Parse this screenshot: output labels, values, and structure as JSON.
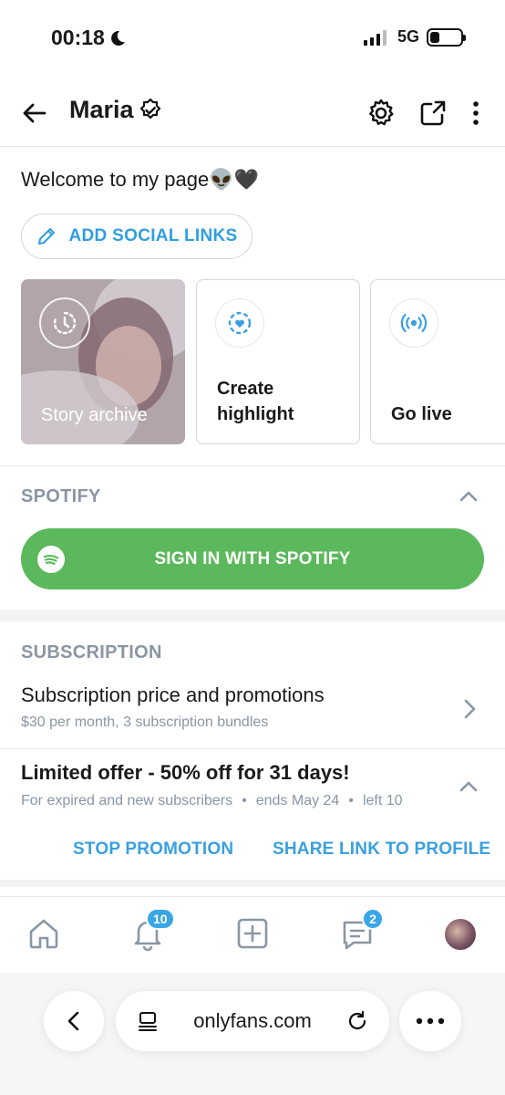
{
  "status_bar": {
    "time": "00:18",
    "network": "5G",
    "battery_percent": 30
  },
  "header": {
    "title": "Maria"
  },
  "profile": {
    "bio": "Welcome to my page👽🖤",
    "add_social_links": "ADD SOCIAL LINKS"
  },
  "cards": [
    {
      "label": "Story archive",
      "icon": "history-clock-icon"
    },
    {
      "label_line1": "Create",
      "label_line2": "highlight",
      "icon": "highlight-heart-icon"
    },
    {
      "label": "Go live",
      "icon": "broadcast-icon"
    }
  ],
  "spotify": {
    "section_title": "SPOTIFY",
    "button_label": "SIGN IN WITH SPOTIFY"
  },
  "subscription": {
    "section_title": "SUBSCRIPTION",
    "price_title": "Subscription price and promotions",
    "price_subtitle": "$30 per month, 3 subscription bundles",
    "offer_title": "Limited offer - 50% off for 31 days!",
    "offer_audience": "For expired and new subscribers",
    "offer_ends": "ends May 24",
    "offer_left": "left 10",
    "stop_promotion": "STOP PROMOTION",
    "share_link": "SHARE LINK TO PROFILE"
  },
  "tabbar": {
    "notifications_badge": "10",
    "messages_badge": "2"
  },
  "browser": {
    "url": "onlyfans.com"
  },
  "colors": {
    "accent": "#3aa0e0",
    "spotify_green": "#5cb85c",
    "muted_text": "#8a96a3",
    "badge_blue": "#3aa6e8"
  }
}
